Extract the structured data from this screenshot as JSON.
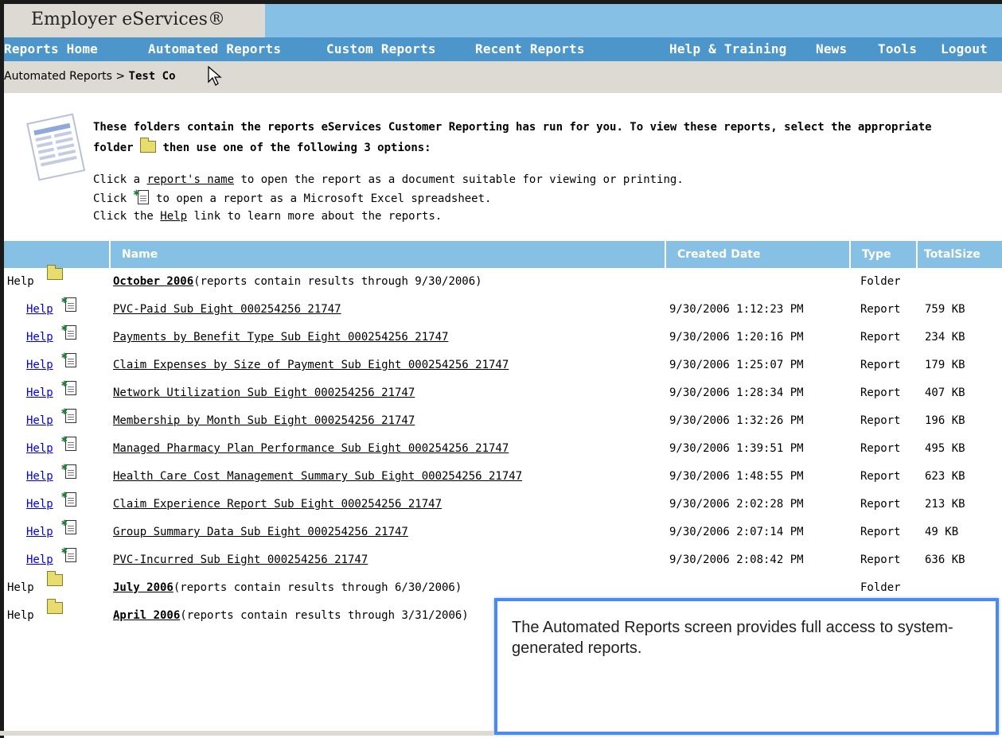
{
  "brand": "Employer eServices®",
  "nav": {
    "items": [
      "Reports Home",
      "Automated Reports",
      "Custom Reports",
      "Recent Reports"
    ],
    "right_items": [
      "Help & Training",
      "News",
      "Tools",
      "Logout"
    ]
  },
  "breadcrumb": {
    "parent": "Automated Reports",
    "sep": ">",
    "current": "Test Co"
  },
  "intro": {
    "heading_a": "These folders contain the reports eServices Customer Reporting has run for you. To view these reports, select the appropriate",
    "heading_b_pre": "folder",
    "heading_b_post": "then use one of the following 3 options:",
    "line1_pre": "Click a",
    "line1_link": "report's name",
    "line1_post": "to open the report as a document suitable for viewing or printing.",
    "line2_pre": "Click",
    "line2_post": "to open a report as a Microsoft Excel spreadsheet.",
    "line3_pre": "Click the",
    "line3_link": "Help",
    "line3_post": "link to learn more about the reports."
  },
  "table": {
    "headers": {
      "name": "Name",
      "created": "Created Date",
      "type": "Type",
      "size": "TotalSize"
    },
    "help_label": "Help",
    "folders": [
      {
        "title": "October 2006",
        "note": "(reports contain results through 9/30/2006)",
        "type": "Folder"
      },
      {
        "title": "July 2006",
        "note": "(reports contain results through 6/30/2006)",
        "type": "Folder"
      },
      {
        "title": "April 2006",
        "note": "(reports contain results through 3/31/2006)",
        "type": ""
      }
    ],
    "reports": [
      {
        "name": "PVC-Paid Sub Eight 000254256 21747",
        "date": "9/30/2006 1:12:23 PM",
        "type": "Report",
        "size": "759 KB"
      },
      {
        "name": "Payments by Benefit Type Sub Eight 000254256 21747",
        "date": "9/30/2006 1:20:16 PM",
        "type": "Report",
        "size": "234 KB"
      },
      {
        "name": "Claim Expenses by Size of Payment Sub Eight 000254256 21747",
        "date": "9/30/2006 1:25:07 PM",
        "type": "Report",
        "size": "179 KB"
      },
      {
        "name": "Network Utilization Sub Eight 000254256 21747",
        "date": "9/30/2006 1:28:34 PM",
        "type": "Report",
        "size": "407 KB"
      },
      {
        "name": "Membership by Month Sub Eight 000254256 21747",
        "date": "9/30/2006 1:32:26 PM",
        "type": "Report",
        "size": "196 KB"
      },
      {
        "name": "Managed Pharmacy Plan Performance Sub Eight 000254256 21747",
        "date": "9/30/2006 1:39:51 PM",
        "type": "Report",
        "size": "495 KB"
      },
      {
        "name": "Health Care Cost Management Summary Sub Eight 000254256 21747",
        "date": "9/30/2006 1:48:55 PM",
        "type": "Report",
        "size": "623 KB"
      },
      {
        "name": "Claim Experience Report Sub Eight 000254256 21747",
        "date": "9/30/2006 2:02:28 PM",
        "type": "Report",
        "size": "213 KB"
      },
      {
        "name": "Group Summary Data Sub Eight 000254256 21747",
        "date": "9/30/2006 2:07:14 PM",
        "type": "Report",
        "size": "49 KB"
      },
      {
        "name": "PVC-Incurred Sub Eight 000254256 21747",
        "date": "9/30/2006 2:08:42 PM",
        "type": "Report",
        "size": "636 KB"
      }
    ]
  },
  "callout": "The Automated Reports screen provides full access to system-generated reports.",
  "colors": {
    "nav": "#4c96cc",
    "titlebar": "#86c0e4",
    "header": "#86c0e4",
    "link": "#0000ee",
    "callout_border": "#4a8af0"
  },
  "icons": {
    "folder": "folder-icon",
    "excel": "excel-icon",
    "report": "report-document-icon",
    "cursor": "mouse-cursor-icon"
  }
}
